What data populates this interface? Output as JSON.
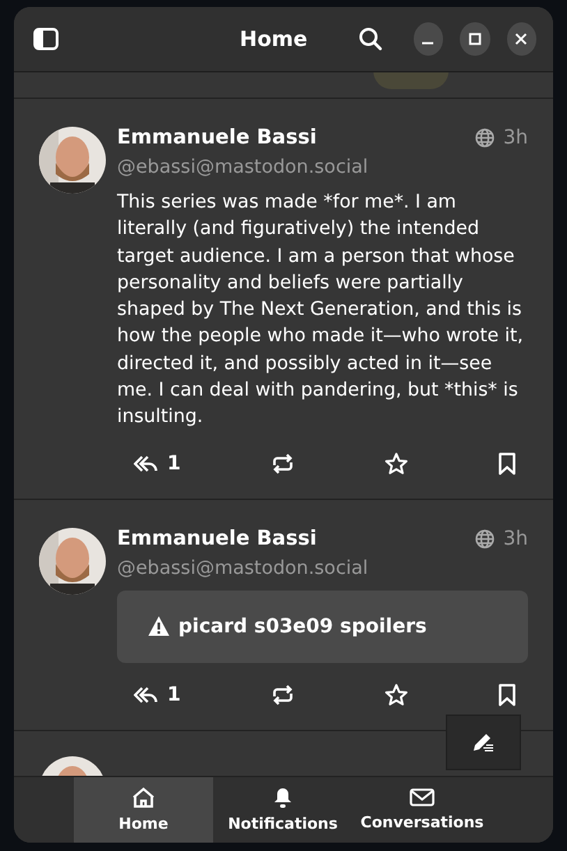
{
  "window": {
    "title": "Home"
  },
  "posts": [
    {
      "kind": "text",
      "author": "Emmanuele Bassi",
      "handle": "@ebassi@mastodon.social",
      "time": "3h",
      "content": "This series was made *for me*. I am literally (and figuratively) the intended target audience. I am a person that whose personality and beliefs were partially shaped by The Next Generation, and this is how the people who made it—who wrote it, directed it, and possibly acted in it—see me. I can deal with pandering, but *this* is insulting.",
      "replies": "1"
    },
    {
      "kind": "spoiler",
      "author": "Emmanuele Bassi",
      "handle": "@ebassi@mastodon.social",
      "time": "3h",
      "spoiler": "picard s03e09 spoilers",
      "replies": "1"
    }
  ],
  "nav": [
    {
      "kind": "home",
      "label": "Home",
      "selected": true
    },
    {
      "kind": "bell",
      "label": "Notifications",
      "selected": false
    },
    {
      "kind": "mail",
      "label": "Conversations",
      "selected": false
    }
  ]
}
